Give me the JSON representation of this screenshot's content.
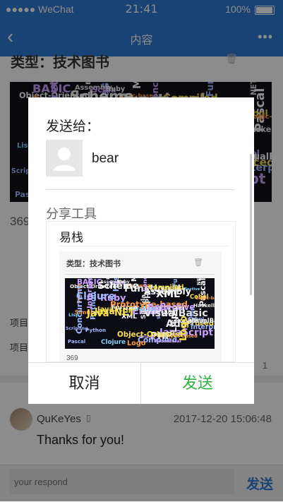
{
  "status": {
    "carrier": "●●●●● WeChat",
    "time": "21:41",
    "battery": "100%"
  },
  "nav": {
    "back": "‹",
    "title": "内容",
    "more": "•••"
  },
  "background": {
    "section_title": "类型：技术图书",
    "trash": "🗑",
    "number": "369",
    "project1": "项目",
    "project2": "项目",
    "count": "1",
    "comment": {
      "user": "QuKeYes",
      "icon": "▯",
      "time": "2017-12-20 15:06:48",
      "text": "Thanks for you!"
    },
    "reply": {
      "placeholder": "your respond",
      "send": "发送"
    }
  },
  "modal": {
    "send_to_label": "发送给：",
    "recipient": "bear",
    "share_tool_label": "分享工具",
    "card_title": "易栈",
    "inner_title": "类型：技术图书",
    "inner_trash": "🗑",
    "inner_number": "369",
    "cancel": "取消",
    "send": "发送"
  },
  "colors": {
    "nav": "#2f7bd6",
    "send_green": "#2fb040"
  },
  "wordcloud": [
    "JavaScript",
    "PHP",
    "Simula",
    "Matlab",
    "NET",
    "XML",
    "Pascal",
    "Python",
    "Cobol",
    "Fortran",
    "Java",
    "Scala",
    "Erlang",
    "Ruby",
    "Lisp",
    "Ada",
    "Haskell",
    "Clojure",
    "Logic-based",
    "VisualBasic",
    "Assembly",
    "Prototype-based",
    "Object-Oriented",
    "Reflective",
    "Markup",
    "Functional",
    "Scheme",
    "Scripting",
    "Interpreted",
    "Concurrent",
    "BASIC",
    "Compiled",
    "Procedural",
    "Logo"
  ]
}
